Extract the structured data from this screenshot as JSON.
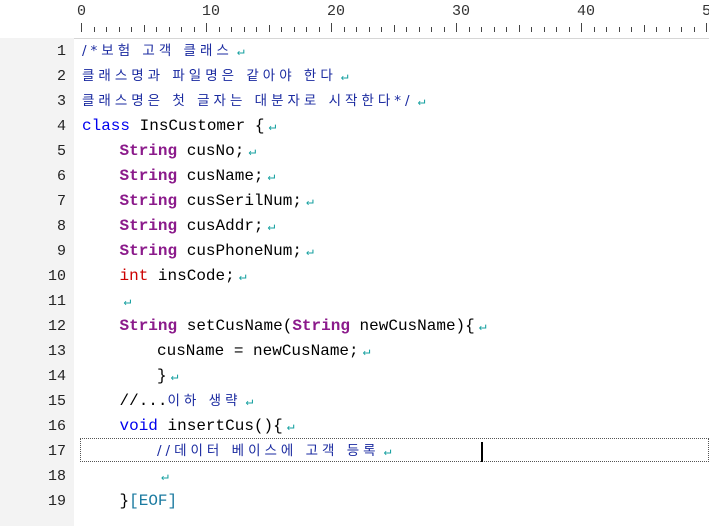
{
  "ruler": {
    "labels": [
      "0",
      "10",
      "20",
      "30",
      "40",
      "50"
    ]
  },
  "colors": {
    "keyword": "#0000ee",
    "type": "#8b1a8b",
    "primitive": "#cc0000",
    "comment": "#1a2aa0",
    "eof": "#1a7aa0",
    "line_end_mark": "#16a0a0"
  },
  "icons": {
    "line_end": "return-arrow-icon"
  },
  "line_end_glyph": "↵",
  "lines": [
    {
      "no": "1",
      "indent": 0,
      "tokens": [
        {
          "c": "cm",
          "t": "/*보험 고객 클래스"
        }
      ],
      "eol": true
    },
    {
      "no": "2",
      "indent": 0,
      "tokens": [
        {
          "c": "cm",
          "t": "클래스명과 파일명은 같아야 한다"
        }
      ],
      "eol": true
    },
    {
      "no": "3",
      "indent": 0,
      "tokens": [
        {
          "c": "cm",
          "t": "클래스명은 첫 글자는 대분자로 시작한다*/"
        }
      ],
      "eol": true
    },
    {
      "no": "4",
      "indent": 0,
      "tokens": [
        {
          "c": "kw",
          "t": "class"
        },
        {
          "c": "",
          "t": " InsCustomer {"
        }
      ],
      "eol": true
    },
    {
      "no": "5",
      "indent": 1,
      "tokens": [
        {
          "c": "type",
          "t": "String"
        },
        {
          "c": "",
          "t": " cusNo;"
        }
      ],
      "eol": true
    },
    {
      "no": "6",
      "indent": 1,
      "tokens": [
        {
          "c": "type",
          "t": "String"
        },
        {
          "c": "",
          "t": " cusName;"
        }
      ],
      "eol": true
    },
    {
      "no": "7",
      "indent": 1,
      "tokens": [
        {
          "c": "type",
          "t": "String"
        },
        {
          "c": "",
          "t": " cusSerilNum;"
        }
      ],
      "eol": true
    },
    {
      "no": "8",
      "indent": 1,
      "tokens": [
        {
          "c": "type",
          "t": "String"
        },
        {
          "c": "",
          "t": " cusAddr;"
        }
      ],
      "eol": true
    },
    {
      "no": "9",
      "indent": 1,
      "tokens": [
        {
          "c": "type",
          "t": "String"
        },
        {
          "c": "",
          "t": " cusPhoneNum;"
        }
      ],
      "eol": true
    },
    {
      "no": "10",
      "indent": 1,
      "tokens": [
        {
          "c": "prim",
          "t": "int"
        },
        {
          "c": "",
          "t": " insCode;"
        }
      ],
      "eol": true
    },
    {
      "no": "11",
      "indent": 1,
      "tokens": [],
      "eol": true
    },
    {
      "no": "12",
      "indent": 1,
      "tokens": [
        {
          "c": "type",
          "t": "String"
        },
        {
          "c": "",
          "t": " setCusName("
        },
        {
          "c": "type",
          "t": "String"
        },
        {
          "c": "",
          "t": " newCusName){"
        }
      ],
      "eol": true
    },
    {
      "no": "13",
      "indent": 2,
      "tokens": [
        {
          "c": "",
          "t": "cusName = newCusName;"
        }
      ],
      "eol": true
    },
    {
      "no": "14",
      "indent": 2,
      "tokens": [
        {
          "c": "",
          "t": "}"
        }
      ],
      "eol": true
    },
    {
      "no": "15",
      "indent": 1,
      "tokens": [
        {
          "c": "",
          "t": "//..."
        },
        {
          "c": "cm",
          "t": "이하 생략"
        }
      ],
      "eol": true
    },
    {
      "no": "16",
      "indent": 1,
      "tokens": [
        {
          "c": "kw",
          "t": "void"
        },
        {
          "c": "",
          "t": " insertCus(){"
        }
      ],
      "eol": true
    },
    {
      "no": "17",
      "indent": 2,
      "tokens": [
        {
          "c": "cm",
          "t": "//데이터 베이스에 고객 등록"
        }
      ],
      "eol": true
    },
    {
      "no": "18",
      "indent": 2,
      "tokens": [],
      "eol": true
    },
    {
      "no": "19",
      "indent": 1,
      "tokens": [
        {
          "c": "",
          "t": "}"
        },
        {
          "c": "eof",
          "t": "[EOF]"
        }
      ],
      "eol": false
    }
  ]
}
